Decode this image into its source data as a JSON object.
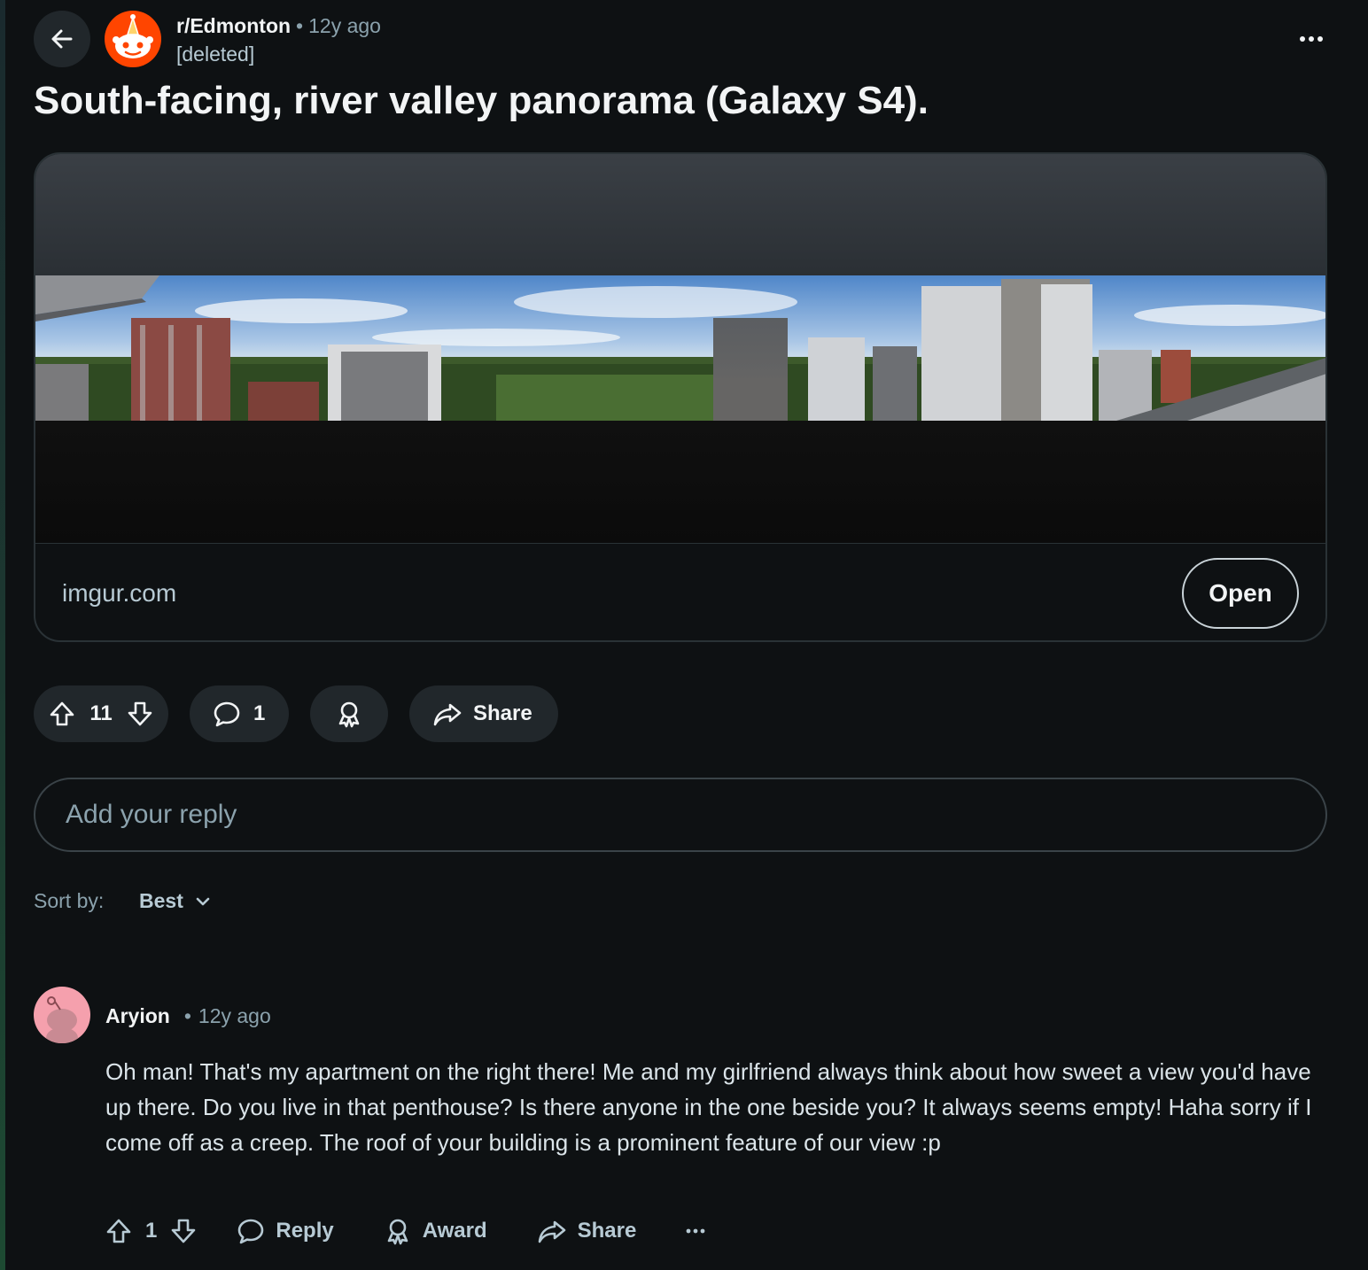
{
  "post": {
    "subreddit": "r/Edmonton",
    "age": "12y ago",
    "author": "[deleted]",
    "title": "South-facing, river valley panorama (Galaxy S4).",
    "link_domain": "imgur.com",
    "open_label": "Open",
    "score": "11",
    "comment_count": "1",
    "share_label": "Share"
  },
  "reply_box": {
    "placeholder": "Add your reply"
  },
  "sort": {
    "label": "Sort by:",
    "value": "Best"
  },
  "comments": [
    {
      "author": "Aryion",
      "age": "12y ago",
      "body": "Oh man! That's my apartment on the right there! Me and my girlfriend always think about how sweet a view you'd have up there. Do you live in that penthouse? Is there anyone in the one beside you? It always seems empty! Haha sorry if I come off as a creep. The roof of your building is a prominent feature of our view :p",
      "score": "1",
      "reply_label": "Reply",
      "award_label": "Award",
      "share_label": "Share"
    }
  ],
  "icons": {
    "back": "back-arrow-icon",
    "more": "more-horizontal-icon",
    "upvote": "upvote-arrow-icon",
    "downvote": "downvote-arrow-icon",
    "comment": "speech-bubble-icon",
    "award": "award-ribbon-icon",
    "share": "share-arrow-icon"
  },
  "colors": {
    "background": "#0e1113",
    "pill": "#21272b",
    "brand": "#ff4500",
    "muted_text": "#8ba2ad",
    "comment_avatar": "#f5a0ad"
  }
}
